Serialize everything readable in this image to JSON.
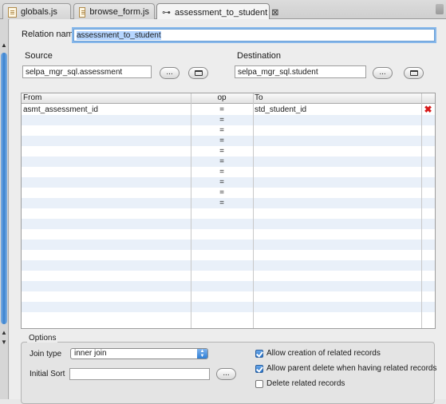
{
  "tabs": [
    {
      "label": "globals.js",
      "icon": "js-file-icon"
    },
    {
      "label": "browse_form.js",
      "icon": "js-file-icon"
    },
    {
      "label": "assessment_to_student",
      "icon": "relation-icon",
      "active": true
    }
  ],
  "relation": {
    "name_label": "Relation name",
    "name_value": "assessment_to_student"
  },
  "source": {
    "label": "Source",
    "value": "selpa_mgr_sql.assessment",
    "browse_label": "..."
  },
  "destination": {
    "label": "Destination",
    "value": "selpa_mgr_sql.student",
    "browse_label": "..."
  },
  "table": {
    "headers": {
      "from": "From",
      "op": "op",
      "to": "To"
    },
    "rows": [
      {
        "from": "asmt_assessment_id",
        "op": "=",
        "to": "std_student_id",
        "delete": true
      },
      {
        "from": "",
        "op": "=",
        "to": ""
      },
      {
        "from": "",
        "op": "=",
        "to": ""
      },
      {
        "from": "",
        "op": "=",
        "to": ""
      },
      {
        "from": "",
        "op": "=",
        "to": ""
      },
      {
        "from": "",
        "op": "=",
        "to": ""
      },
      {
        "from": "",
        "op": "=",
        "to": ""
      },
      {
        "from": "",
        "op": "=",
        "to": ""
      },
      {
        "from": "",
        "op": "=",
        "to": ""
      },
      {
        "from": "",
        "op": "=",
        "to": ""
      }
    ],
    "delete_color": "#d71a1a",
    "stripe_color": "#e9f0f9"
  },
  "options": {
    "title": "Options",
    "join_type_label": "Join type",
    "join_type_value": "inner join",
    "initial_sort_label": "Initial Sort",
    "initial_sort_value": "",
    "sort_browse_label": "...",
    "checkboxes": [
      {
        "label": "Allow creation of related records",
        "checked": true
      },
      {
        "label": "Allow parent delete when having related records",
        "checked": true
      },
      {
        "label": "Delete related records",
        "checked": false
      }
    ]
  },
  "colors": {
    "accent": "#3a82cf",
    "selection": "#b5d5ff"
  }
}
